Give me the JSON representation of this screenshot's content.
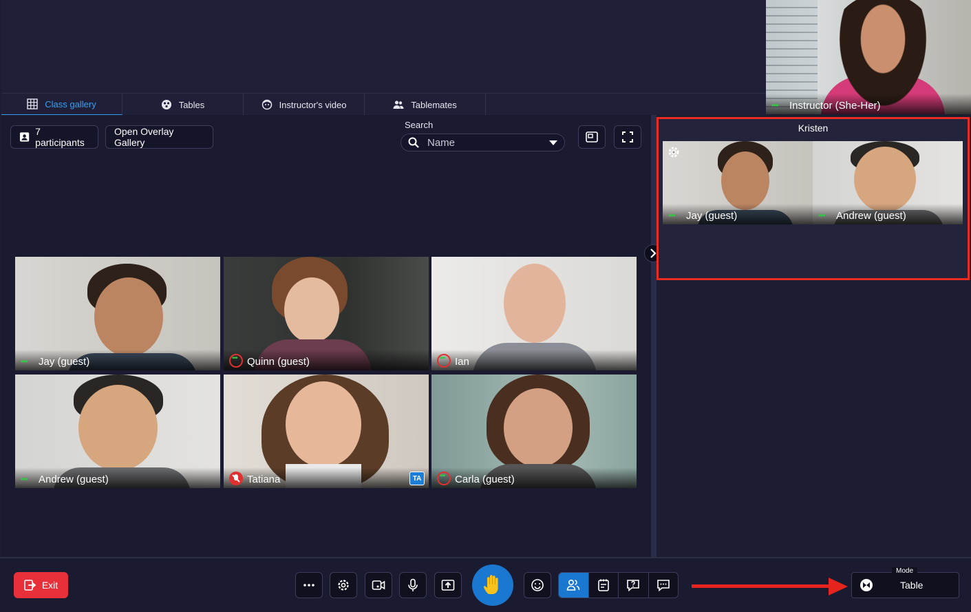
{
  "instructor": {
    "name": "Instructor (She-Her)"
  },
  "tabs": [
    {
      "label": "Class gallery",
      "icon": "grid-icon",
      "active": true
    },
    {
      "label": "Tables",
      "icon": "tables-icon",
      "active": false
    },
    {
      "label": "Instructor's video",
      "icon": "face-icon",
      "active": false
    },
    {
      "label": "Tablemates",
      "icon": "people-icon",
      "active": false
    }
  ],
  "toolbar": {
    "participants_label": "7 participants",
    "overlay_label": "Open Overlay Gallery",
    "search_label": "Search",
    "search_value": "Name"
  },
  "participants": [
    {
      "name": "Jay (guest)",
      "status": "connected"
    },
    {
      "name": "Quinn (guest)",
      "status": "connecting"
    },
    {
      "name": "Ian",
      "status": "connecting"
    },
    {
      "name": "Andrew (guest)",
      "status": "connected"
    },
    {
      "name": "Tatiana",
      "status": "muted",
      "badge": "TA"
    },
    {
      "name": "Carla (guest)",
      "status": "connecting"
    }
  ],
  "table": {
    "title": "Kristen",
    "members": [
      {
        "name": "Jay (guest)"
      },
      {
        "name": "Andrew (guest)"
      }
    ]
  },
  "bottom": {
    "exit_label": "Exit",
    "mode_label": "Mode",
    "mode_value": "Table"
  },
  "colors": {
    "accent": "#1b78d0",
    "exit": "#e8303a",
    "highlight": "#ea2b22",
    "status_green": "#2ecc40"
  }
}
